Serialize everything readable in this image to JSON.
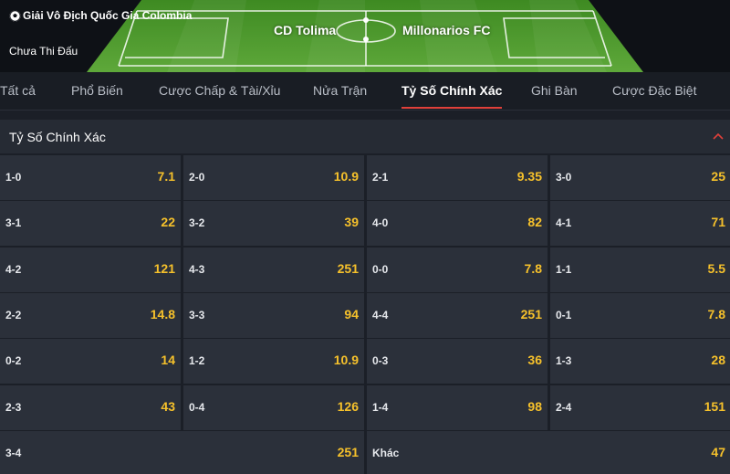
{
  "match": {
    "league": "Giải Vô Địch Quốc Gia Colombia",
    "status": "Chưa Thi Đấu",
    "home_team": "CD Tolima",
    "away_team": "Millonarios FC"
  },
  "tabs": [
    {
      "label": "Tất cả",
      "active": false
    },
    {
      "label": "Phổ Biến",
      "active": false
    },
    {
      "label": "Cược Chấp & Tài/Xỉu",
      "active": false
    },
    {
      "label": "Nửa Trận",
      "active": false
    },
    {
      "label": "Tỷ Số Chính Xác",
      "active": true
    },
    {
      "label": "Ghi Bàn",
      "active": false
    },
    {
      "label": "Cược Đặc Biệt",
      "active": false
    }
  ],
  "section": {
    "title": "Tỷ Số Chính Xác",
    "expanded": true
  },
  "odds": [
    {
      "score": "1-0",
      "odd": "7.1"
    },
    {
      "score": "2-0",
      "odd": "10.9"
    },
    {
      "score": "2-1",
      "odd": "9.35"
    },
    {
      "score": "3-0",
      "odd": "25"
    },
    {
      "score": "3-1",
      "odd": "22"
    },
    {
      "score": "3-2",
      "odd": "39"
    },
    {
      "score": "4-0",
      "odd": "82"
    },
    {
      "score": "4-1",
      "odd": "71"
    },
    {
      "score": "4-2",
      "odd": "121"
    },
    {
      "score": "4-3",
      "odd": "251"
    },
    {
      "score": "0-0",
      "odd": "7.8"
    },
    {
      "score": "1-1",
      "odd": "5.5"
    },
    {
      "score": "2-2",
      "odd": "14.8"
    },
    {
      "score": "3-3",
      "odd": "94"
    },
    {
      "score": "4-4",
      "odd": "251"
    },
    {
      "score": "0-1",
      "odd": "7.8"
    },
    {
      "score": "0-2",
      "odd": "14"
    },
    {
      "score": "1-2",
      "odd": "10.9"
    },
    {
      "score": "0-3",
      "odd": "36"
    },
    {
      "score": "1-3",
      "odd": "28"
    },
    {
      "score": "2-3",
      "odd": "43"
    },
    {
      "score": "0-4",
      "odd": "126"
    },
    {
      "score": "1-4",
      "odd": "98"
    },
    {
      "score": "2-4",
      "odd": "151"
    },
    {
      "score": "3-4",
      "odd": "251"
    },
    {
      "score": "Khác",
      "odd": "47"
    }
  ],
  "colors": {
    "background": "#1b1f27",
    "cell": "#2b303a",
    "odd_text": "#f6c12b",
    "active_tab_underline": "#e0403a",
    "pitch": "#4f9a2c"
  },
  "icons": {
    "league": "soccer-ball-icon",
    "section_toggle": "chevron-up-icon"
  }
}
